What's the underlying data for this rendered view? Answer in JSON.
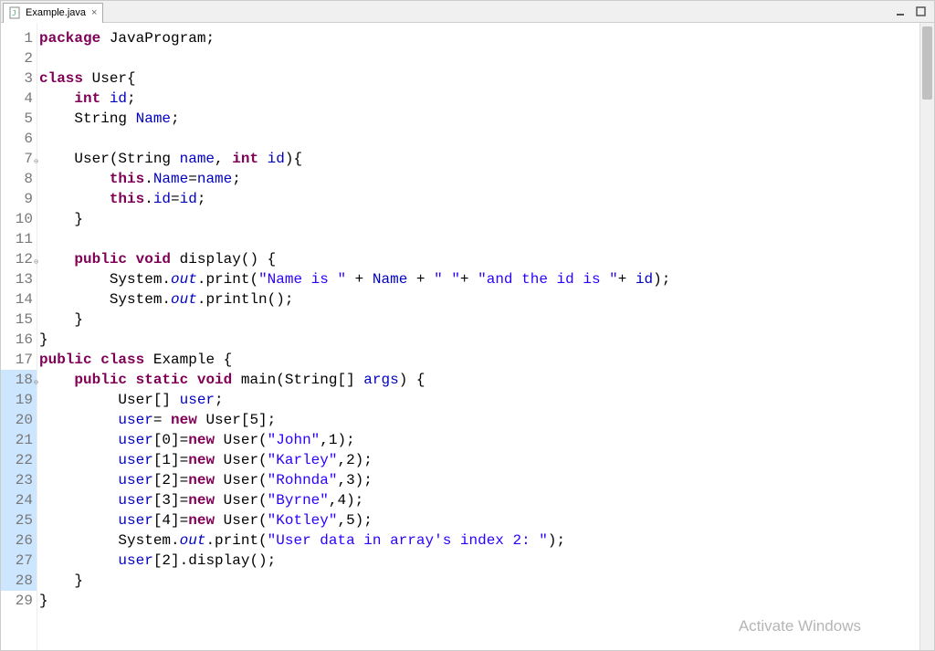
{
  "tab": {
    "label": "Example.java",
    "close": "×"
  },
  "lineNumbers": [
    "1",
    "2",
    "3",
    "4",
    "5",
    "6",
    "7",
    "8",
    "9",
    "10",
    "11",
    "12",
    "13",
    "14",
    "15",
    "16",
    "17",
    "18",
    "19",
    "20",
    "21",
    "22",
    "23",
    "24",
    "25",
    "26",
    "27",
    "28",
    "29"
  ],
  "code": [
    [
      {
        "c": "kw",
        "t": "package"
      },
      {
        "t": " JavaProgram;"
      }
    ],
    [],
    [
      {
        "c": "kw",
        "t": "class"
      },
      {
        "t": " User{"
      }
    ],
    [
      {
        "t": "    "
      },
      {
        "c": "kw",
        "t": "int"
      },
      {
        "t": " "
      },
      {
        "c": "field",
        "t": "id"
      },
      {
        "t": ";"
      }
    ],
    [
      {
        "t": "    String "
      },
      {
        "c": "field",
        "t": "Name"
      },
      {
        "t": ";"
      }
    ],
    [],
    [
      {
        "t": "    User(String "
      },
      {
        "c": "field",
        "t": "name"
      },
      {
        "t": ", "
      },
      {
        "c": "kw",
        "t": "int"
      },
      {
        "t": " "
      },
      {
        "c": "field",
        "t": "id"
      },
      {
        "t": "){"
      }
    ],
    [
      {
        "t": "        "
      },
      {
        "c": "kw",
        "t": "this"
      },
      {
        "t": "."
      },
      {
        "c": "field",
        "t": "Name"
      },
      {
        "t": "="
      },
      {
        "c": "field",
        "t": "name"
      },
      {
        "t": ";"
      }
    ],
    [
      {
        "t": "        "
      },
      {
        "c": "kw",
        "t": "this"
      },
      {
        "t": "."
      },
      {
        "c": "field",
        "t": "id"
      },
      {
        "t": "="
      },
      {
        "c": "field",
        "t": "id"
      },
      {
        "t": ";"
      }
    ],
    [
      {
        "t": "    }"
      }
    ],
    [],
    [
      {
        "t": "    "
      },
      {
        "c": "kw",
        "t": "public"
      },
      {
        "t": " "
      },
      {
        "c": "kw",
        "t": "void"
      },
      {
        "t": " display() {"
      }
    ],
    [
      {
        "t": "        System."
      },
      {
        "c": "stat",
        "t": "out"
      },
      {
        "t": ".print("
      },
      {
        "c": "str",
        "t": "\"Name is \""
      },
      {
        "t": " + "
      },
      {
        "c": "field",
        "t": "Name"
      },
      {
        "t": " + "
      },
      {
        "c": "str",
        "t": "\" \""
      },
      {
        "t": "+ "
      },
      {
        "c": "str",
        "t": "\"and the id is \""
      },
      {
        "t": "+ "
      },
      {
        "c": "field",
        "t": "id"
      },
      {
        "t": ");"
      }
    ],
    [
      {
        "t": "        System."
      },
      {
        "c": "stat",
        "t": "out"
      },
      {
        "t": ".println();"
      }
    ],
    [
      {
        "t": "    }"
      }
    ],
    [
      {
        "t": "}"
      }
    ],
    [
      {
        "c": "kw",
        "t": "public"
      },
      {
        "t": " "
      },
      {
        "c": "kw",
        "t": "class"
      },
      {
        "t": " Example {"
      }
    ],
    [
      {
        "t": "    "
      },
      {
        "c": "kw",
        "t": "public"
      },
      {
        "t": " "
      },
      {
        "c": "kw",
        "t": "static"
      },
      {
        "t": " "
      },
      {
        "c": "kw",
        "t": "void"
      },
      {
        "t": " main(String[] "
      },
      {
        "c": "field",
        "t": "args"
      },
      {
        "t": ") {"
      }
    ],
    [
      {
        "t": "         User[] "
      },
      {
        "c": "field",
        "t": "user"
      },
      {
        "t": ";"
      }
    ],
    [
      {
        "t": "         "
      },
      {
        "c": "field",
        "t": "user"
      },
      {
        "t": "= "
      },
      {
        "c": "kw",
        "t": "new"
      },
      {
        "t": " User[5];"
      }
    ],
    [
      {
        "t": "         "
      },
      {
        "c": "field",
        "t": "user"
      },
      {
        "t": "[0]="
      },
      {
        "c": "kw",
        "t": "new"
      },
      {
        "t": " User("
      },
      {
        "c": "str",
        "t": "\"John\""
      },
      {
        "t": ",1);"
      }
    ],
    [
      {
        "t": "         "
      },
      {
        "c": "field",
        "t": "user"
      },
      {
        "t": "[1]="
      },
      {
        "c": "kw",
        "t": "new"
      },
      {
        "t": " User("
      },
      {
        "c": "str",
        "t": "\"Karley\""
      },
      {
        "t": ",2);"
      }
    ],
    [
      {
        "t": "         "
      },
      {
        "c": "field",
        "t": "user"
      },
      {
        "t": "[2]="
      },
      {
        "c": "kw",
        "t": "new"
      },
      {
        "t": " User("
      },
      {
        "c": "str",
        "t": "\"Rohnda\""
      },
      {
        "t": ",3);"
      }
    ],
    [
      {
        "t": "         "
      },
      {
        "c": "field",
        "t": "user"
      },
      {
        "t": "[3]="
      },
      {
        "c": "kw",
        "t": "new"
      },
      {
        "t": " User("
      },
      {
        "c": "str",
        "t": "\"Byrne\""
      },
      {
        "t": ",4);"
      }
    ],
    [
      {
        "t": "         "
      },
      {
        "c": "field",
        "t": "user"
      },
      {
        "t": "[4]="
      },
      {
        "c": "kw",
        "t": "new"
      },
      {
        "t": " User("
      },
      {
        "c": "str",
        "t": "\"Kotley\""
      },
      {
        "t": ",5);"
      }
    ],
    [
      {
        "t": "         System."
      },
      {
        "c": "stat",
        "t": "out"
      },
      {
        "t": ".print("
      },
      {
        "c": "str",
        "t": "\"User data in array's index 2: \""
      },
      {
        "t": ");"
      }
    ],
    [
      {
        "t": "         "
      },
      {
        "c": "field",
        "t": "user"
      },
      {
        "t": "[2].display();"
      }
    ],
    [
      {
        "t": "    }"
      }
    ],
    [
      {
        "t": "}"
      }
    ]
  ],
  "highlightRange": [
    18,
    28
  ],
  "foldAnnotations": {
    "7": "⊖",
    "12": "⊖",
    "18": "⊖"
  },
  "watermark": "Activate Windows"
}
